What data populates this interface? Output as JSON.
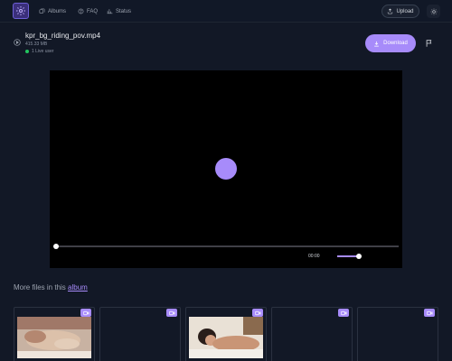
{
  "nav": {
    "logo_icon": "gear-logo-icon",
    "items": [
      {
        "label": "Albums",
        "icon": "albums-icon"
      },
      {
        "label": "FAQ",
        "icon": "help-icon"
      },
      {
        "label": "Status",
        "icon": "status-icon"
      }
    ],
    "upload_label": "Upload",
    "theme_icon": "sun-icon"
  },
  "file": {
    "name": "kpr_bg_riding_pov.mp4",
    "size": "415.33 MB",
    "live_users": "1 Live user",
    "download_label": "Download",
    "report_icon": "flag-icon"
  },
  "player": {
    "time": "00:00",
    "progress": 0,
    "volume": 1.0
  },
  "more_files": {
    "prefix": "More files in this",
    "link_text": "album"
  },
  "colors": {
    "accent": "#a78bfa",
    "background": "#121826",
    "live": "#22c55e"
  }
}
